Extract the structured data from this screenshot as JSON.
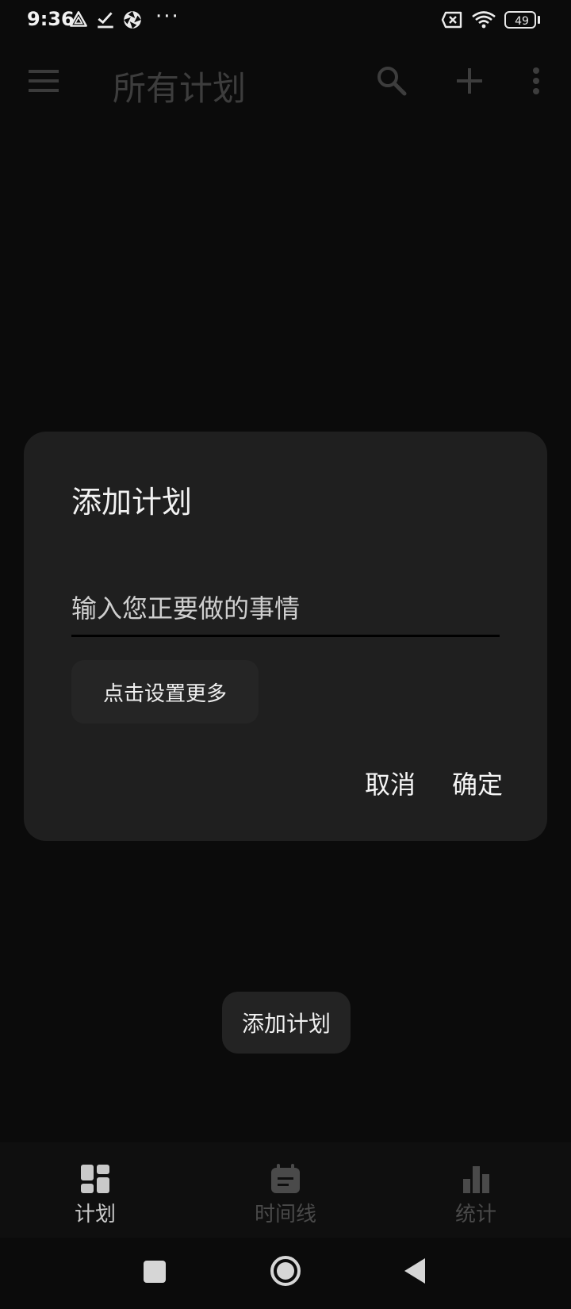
{
  "status_bar": {
    "time": "9:36",
    "dots": "···",
    "battery": "49",
    "icons": [
      "location-triangle-icon",
      "check-download-icon",
      "aperture-icon",
      "sim-disabled-icon",
      "wifi-icon",
      "battery-icon"
    ]
  },
  "app_bar": {
    "title": "所有计划",
    "icons": [
      "menu-icon",
      "search-icon",
      "add-icon",
      "more-vert-icon"
    ]
  },
  "dialog": {
    "title": "添加计划",
    "input_placeholder": "输入您正要做的事情",
    "more_settings_label": "点击设置更多",
    "cancel_label": "取消",
    "confirm_label": "确定"
  },
  "toast": {
    "text": "添加计划"
  },
  "bottom_nav": {
    "items": [
      {
        "label": "计划",
        "icon": "dashboard-icon",
        "active": true
      },
      {
        "label": "时间线",
        "icon": "calendar-note-icon",
        "active": false
      },
      {
        "label": "统计",
        "icon": "bar-chart-icon",
        "active": false
      }
    ]
  },
  "system_nav": {
    "icons": [
      "recents-icon",
      "home-icon",
      "back-icon"
    ]
  },
  "colors": {
    "background": "#0b0b0b",
    "dialog": "#1f1f1f",
    "active_nav": "#c9c9c9",
    "inactive_nav": "#4a4a4a"
  }
}
